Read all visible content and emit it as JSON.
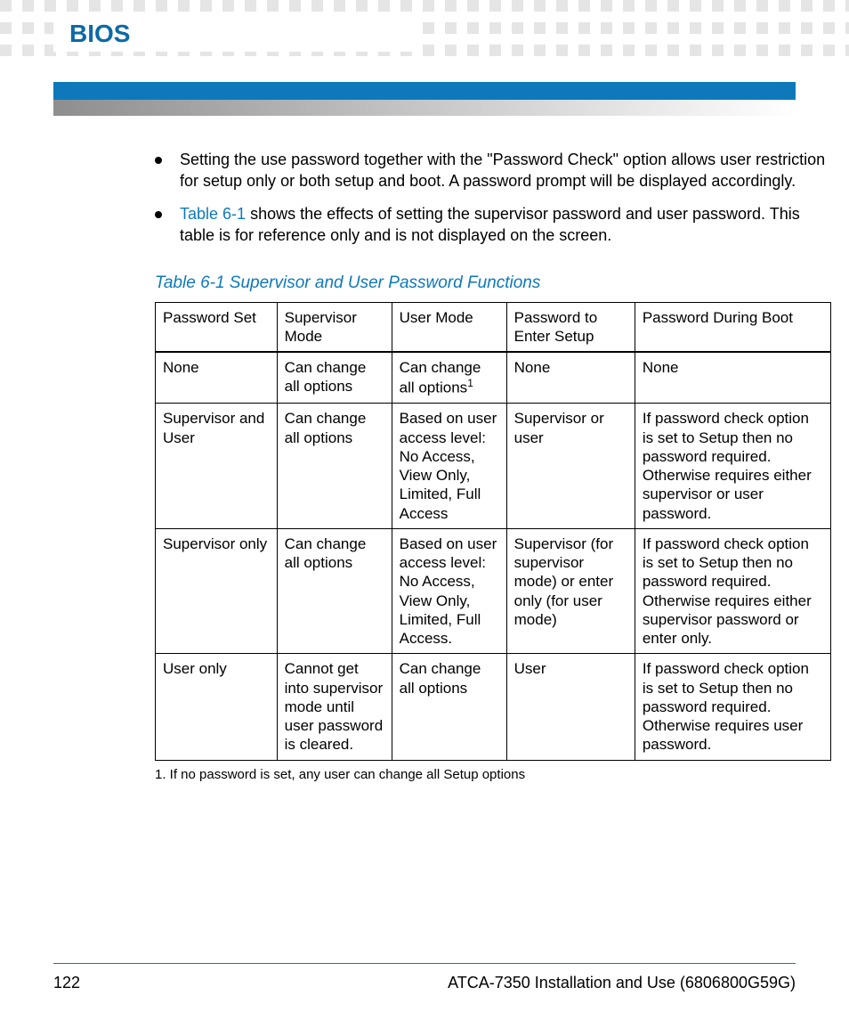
{
  "header": {
    "section_title": "BIOS"
  },
  "bullets": [
    {
      "text": "Setting the use password together with the \"Password Check\" option allows user restriction for setup only or both setup and boot. A password prompt will be displayed accordingly."
    },
    {
      "link": "Table 6-1",
      "rest": " shows the effects of setting the supervisor password and user password. This table is for reference only and is not displayed on the screen."
    }
  ],
  "table": {
    "caption": "Table 6-1 Supervisor and User Password Functions",
    "headers": [
      "Password Set",
      "Supervisor Mode",
      "User Mode",
      "Password to Enter Setup",
      "Password During Boot"
    ],
    "rows": [
      [
        "None",
        "Can change all options",
        "Can change all options",
        "None",
        "None"
      ],
      [
        "Supervisor and User",
        "Can change all options",
        "Based on user access level: No Access, View Only, Limited, Full Access",
        "Supervisor or user",
        "If password check option is set to Setup then no password required. Otherwise requires either supervisor or user password."
      ],
      [
        "Supervisor only",
        "Can change all options",
        "Based on user access level: No Access, View Only, Limited, Full Access.",
        "Supervisor (for supervisor mode) or enter only (for user mode)",
        "If password check option is set to Setup then no password required. Otherwise requires either supervisor password or enter only."
      ],
      [
        "User only",
        "Cannot get into supervisor mode until user password is cleared.",
        "Can change all options",
        "User",
        "If password check option is set to Setup then no password required. Otherwise requires user password."
      ]
    ],
    "footnote_marker_cell": [
      0,
      2
    ],
    "footnote": "1. If no password is set, any user can change all Setup options"
  },
  "footer": {
    "page_number": "122",
    "doc_title": "ATCA-7350 Installation and Use (6806800G59G)"
  },
  "chart_data": {
    "type": "table",
    "title": "Table 6-1 Supervisor and User Password Functions",
    "columns": [
      "Password Set",
      "Supervisor Mode",
      "User Mode",
      "Password to Enter Setup",
      "Password During Boot"
    ],
    "rows": [
      {
        "Password Set": "None",
        "Supervisor Mode": "Can change all options",
        "User Mode": "Can change all options (footnote 1)",
        "Password to Enter Setup": "None",
        "Password During Boot": "None"
      },
      {
        "Password Set": "Supervisor and User",
        "Supervisor Mode": "Can change all options",
        "User Mode": "Based on user access level: No Access, View Only, Limited, Full Access",
        "Password to Enter Setup": "Supervisor or user",
        "Password During Boot": "If password check option is set to Setup then no password required. Otherwise requires either supervisor or user password."
      },
      {
        "Password Set": "Supervisor only",
        "Supervisor Mode": "Can change all options",
        "User Mode": "Based on user access level: No Access, View Only, Limited, Full Access.",
        "Password to Enter Setup": "Supervisor (for supervisor mode) or enter only (for user mode)",
        "Password During Boot": "If password check option is set to Setup then no password required. Otherwise requires either supervisor password or enter only."
      },
      {
        "Password Set": "User only",
        "Supervisor Mode": "Cannot get into supervisor mode until user password is cleared.",
        "User Mode": "Can change all options",
        "Password to Enter Setup": "User",
        "Password During Boot": "If password check option is set to Setup then no password required. Otherwise requires user password."
      }
    ],
    "footnotes": {
      "1": "If no password is set, any user can change all Setup options"
    }
  }
}
